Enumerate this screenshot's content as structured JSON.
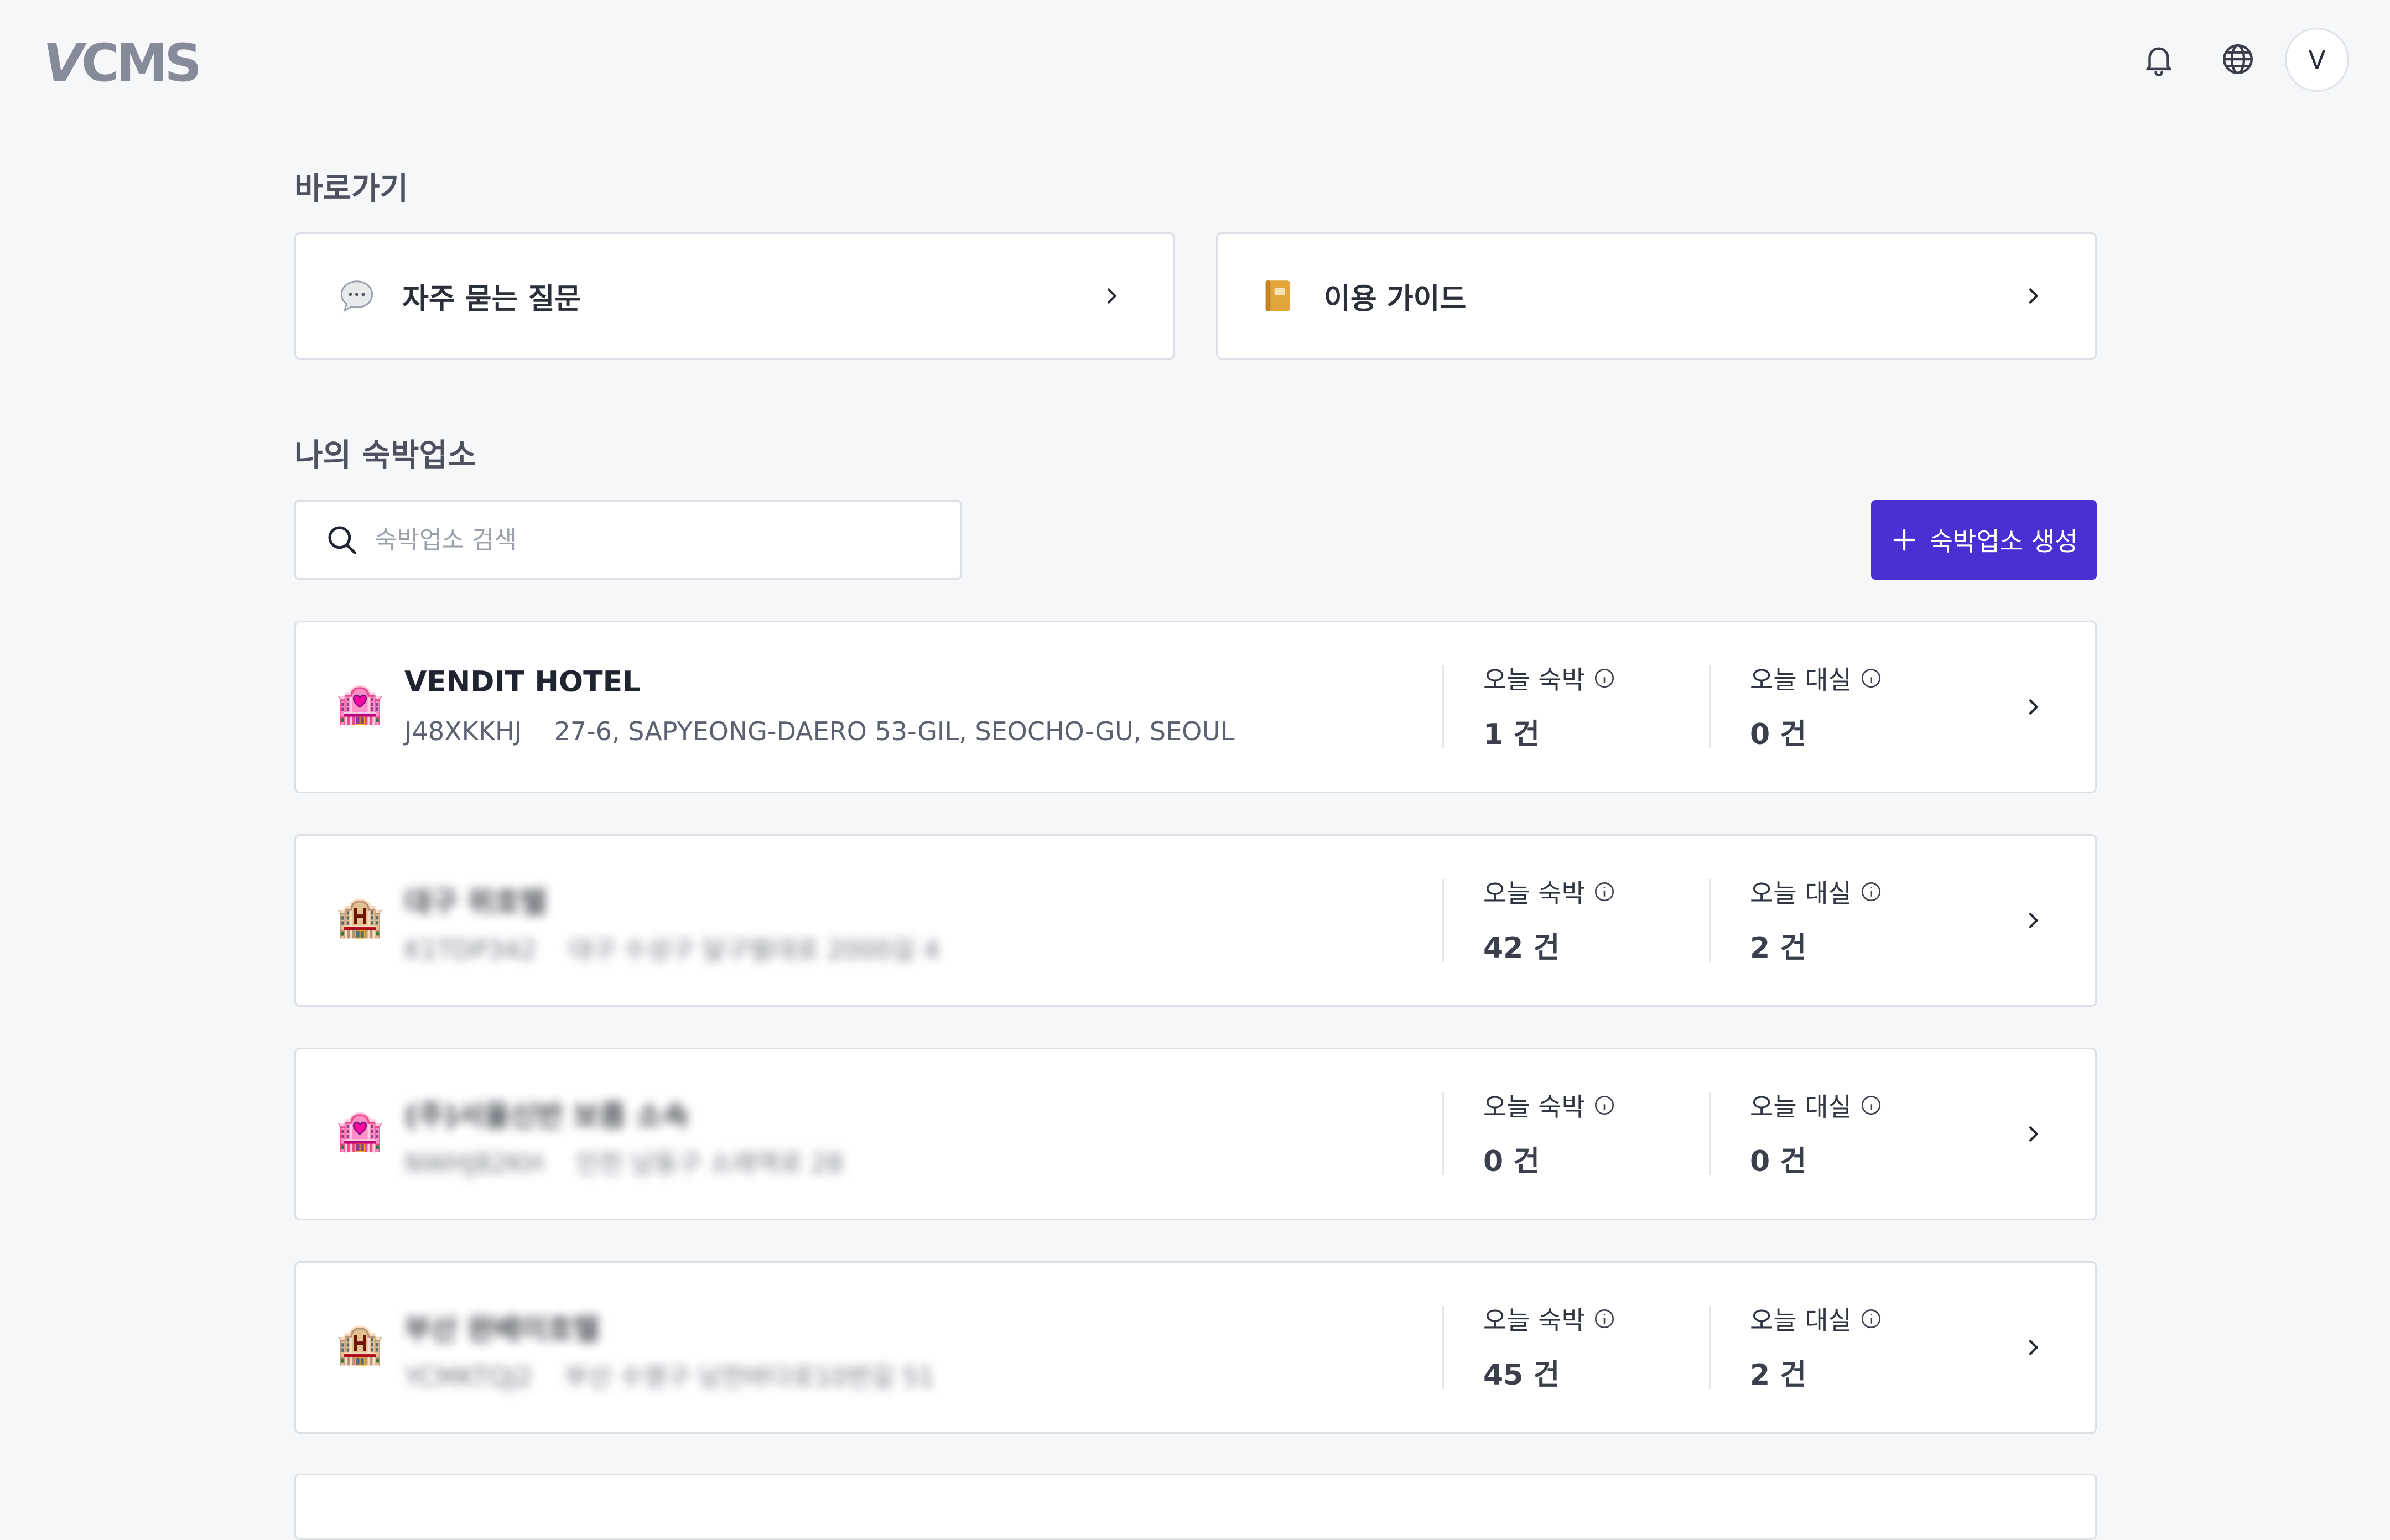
{
  "header": {
    "logo": "VCMS",
    "icons": [
      "bell-icon",
      "globe-icon"
    ],
    "avatar_initial": "V"
  },
  "shortcuts": {
    "title": "바로가기",
    "items": [
      {
        "label": "자주 묻는 질문",
        "icon": "speech-bubble-icon"
      },
      {
        "label": "이용 가이드",
        "icon": "guide-book-icon"
      }
    ]
  },
  "properties": {
    "title": "나의 숙박업소",
    "search_placeholder": "숙박업소 검색",
    "create_label": "숙박업소 생성",
    "stat_labels": {
      "stay": "오늘 숙박",
      "rental": "오늘 대실"
    },
    "list": [
      {
        "name": "VENDIT HOTEL",
        "code": "J48XKKHJ",
        "address": "27-6, SAPYEONG-DAERO 53-GIL, SEOCHO-GU, SEOUL",
        "stay": "1 건",
        "rental": "0 건",
        "icon": "love-hotel-icon",
        "blurred": false
      },
      {
        "name": "대구 위호텔",
        "code": "K1TDP342",
        "address": "대구 수성구 달구벌대로 2000길 4",
        "stay": "42 건",
        "rental": "2 건",
        "icon": "hotel-icon",
        "blurred": true
      },
      {
        "name": "(주)서울신반 보름 소속",
        "code": "NWHJ82KH",
        "address": "인천 남동구 소래역로 28",
        "stay": "0 건",
        "rental": "0 건",
        "icon": "love-hotel-icon",
        "blurred": true
      },
      {
        "name": "부산 완베이호텔",
        "code": "YCMKTQJ2",
        "address": "부산 수영구 남천바다로10번길 51",
        "stay": "45 건",
        "rental": "2 건",
        "icon": "hotel-icon",
        "blurred": true
      }
    ]
  },
  "colors": {
    "primary": "#4a2fd2",
    "background": "#f6f7f9",
    "border": "#dcdfe5"
  }
}
